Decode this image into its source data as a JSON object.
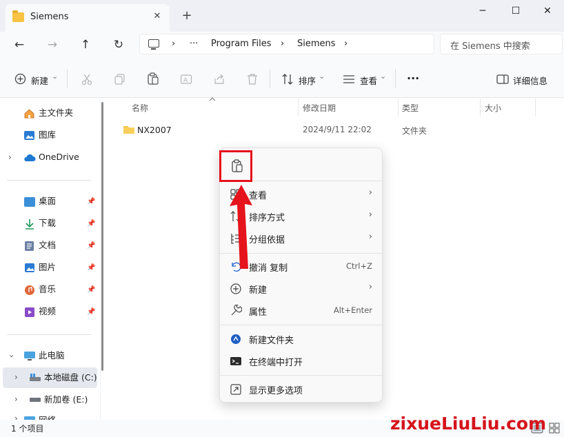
{
  "window": {
    "tab_title": "Siemens",
    "tab_close": "✕",
    "new_tab": "+",
    "minimize": "─",
    "maximize": "☐",
    "close": "✕"
  },
  "nav": {
    "back": "←",
    "forward": "→",
    "up": "↑",
    "refresh": "↻"
  },
  "address": {
    "sep": "›",
    "ellipsis": "···",
    "crumbs": [
      "Program Files",
      "Siemens"
    ]
  },
  "search": {
    "placeholder": "在 Siemens 中搜索"
  },
  "toolbar": {
    "new_label": "新建",
    "sort_label": "排序",
    "view_label": "查看",
    "more": "···",
    "details_label": "详细信息",
    "dropdown": "⌄"
  },
  "sidebar": {
    "items": [
      {
        "label": "主文件夹"
      },
      {
        "label": "图库"
      },
      {
        "label": "OneDrive"
      },
      {
        "label": "桌面"
      },
      {
        "label": "下载"
      },
      {
        "label": "文档"
      },
      {
        "label": "图片"
      },
      {
        "label": "音乐"
      },
      {
        "label": "视频"
      },
      {
        "label": "此电脑"
      },
      {
        "label": "本地磁盘 (C:)"
      },
      {
        "label": "新加卷 (E:)"
      },
      {
        "label": "网络"
      }
    ]
  },
  "columns": {
    "name": "名称",
    "modified": "修改日期",
    "type": "类型",
    "size": "大小"
  },
  "files": [
    {
      "name": "NX2007",
      "modified": "2024/9/11 22:02",
      "type": "文件夹"
    }
  ],
  "status": {
    "count": "1 个项目"
  },
  "context_menu": {
    "view": "查看",
    "sort": "排序方式",
    "group": "分组依据",
    "undo": "撤消 复制",
    "undo_shortcut": "Ctrl+Z",
    "new": "新建",
    "properties": "属性",
    "properties_shortcut": "Alt+Enter",
    "new_folder": "新建文件夹",
    "terminal": "在终端中打开",
    "more_options": "显示更多选项",
    "chevron": "›"
  },
  "watermark": "zixueLiuLiu.com",
  "colors": {
    "annotation_red": "#e5131b",
    "folder": "#f6c343"
  }
}
